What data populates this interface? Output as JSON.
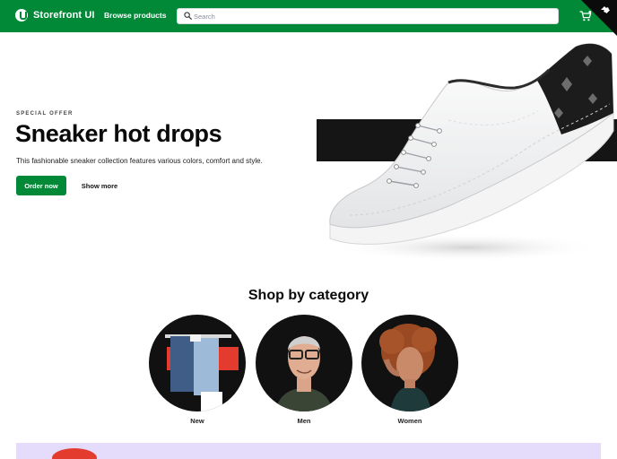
{
  "header": {
    "brand": "Storefront UI",
    "browse_label": "Browse products",
    "search_placeholder": "Search",
    "brand_color": "#018937"
  },
  "hero": {
    "eyebrow": "SPECIAL OFFER",
    "title": "Sneaker hot drops",
    "subtitle": "This fashionable sneaker collection features various colors, comfort and style.",
    "primary_label": "Order now",
    "secondary_label": "Show more"
  },
  "categories": {
    "title": "Shop by category",
    "items": [
      {
        "label": "New"
      },
      {
        "label": "Men"
      },
      {
        "label": "Women"
      }
    ]
  },
  "colors": {
    "accent": "#018937",
    "promo_background": "#e5dcfb"
  }
}
